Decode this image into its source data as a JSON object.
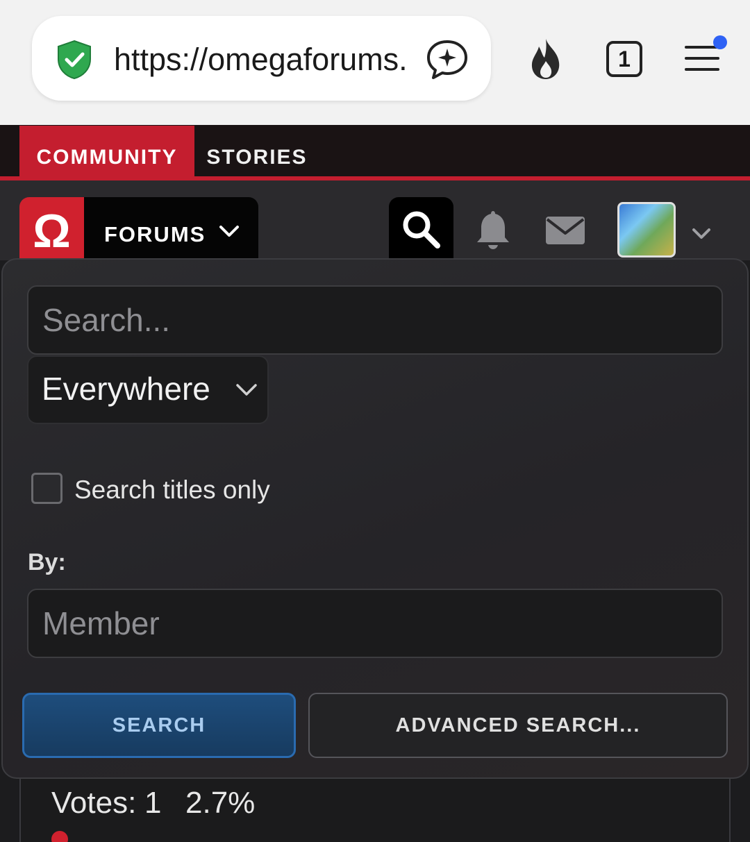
{
  "browser": {
    "url": "https://omegaforums.net",
    "tab_count": "1",
    "icons": [
      "shield-check-icon",
      "ai-sparkle-chat-icon",
      "fire-icon",
      "tabs-icon",
      "menu-icon"
    ],
    "colors": {
      "shield": "#2fa84f",
      "notification_dot": "#2f62f5"
    }
  },
  "site": {
    "top_tabs": [
      {
        "label": "COMMUNITY",
        "active": true
      },
      {
        "label": "STORIES",
        "active": false
      }
    ],
    "logo_glyph": "Ω",
    "forums_label": "FORUMS",
    "colors": {
      "brand_red": "#c41e2f",
      "header_bg": "#1a1314"
    },
    "nav_icons": [
      "search-icon",
      "bell-icon",
      "mail-icon",
      "avatar",
      "chevron-down-icon"
    ]
  },
  "search_panel": {
    "search_placeholder": "Search...",
    "scope_value": "Everywhere",
    "titles_only_label": "Search titles only",
    "titles_only_checked": false,
    "by_label": "By:",
    "member_placeholder": "Member",
    "search_button": "SEARCH",
    "advanced_button": "ADVANCED SEARCH...",
    "colors": {
      "primary_button": "#1e4d7c",
      "primary_border": "#2a6bb0"
    }
  },
  "poll": {
    "votes_label": "Votes:",
    "votes_count": "1",
    "votes_percent": "2.7%"
  }
}
